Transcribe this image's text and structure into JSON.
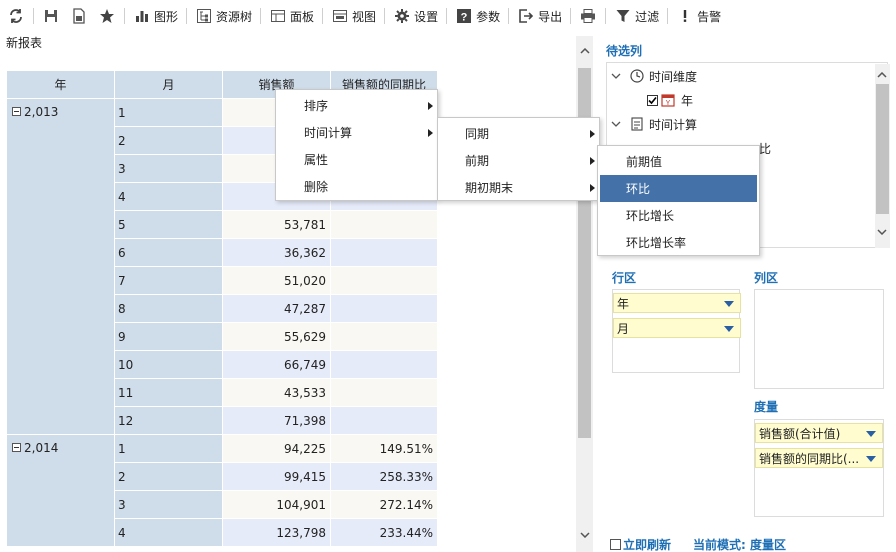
{
  "toolbar": {
    "items": [
      {
        "icon": "refresh-icon",
        "label": ""
      },
      {
        "icon": "save-icon",
        "label": ""
      },
      {
        "icon": "save-as-icon",
        "label": ""
      },
      {
        "icon": "star-icon",
        "label": ""
      },
      {
        "icon": "chart-icon",
        "label": "图形"
      },
      {
        "icon": "resource-tree-icon",
        "label": "资源树"
      },
      {
        "icon": "panel-icon",
        "label": "面板"
      },
      {
        "icon": "view-icon",
        "label": "视图"
      },
      {
        "icon": "gear-icon",
        "label": "设置"
      },
      {
        "icon": "question-icon",
        "label": "参数"
      },
      {
        "icon": "export-icon",
        "label": "导出"
      },
      {
        "icon": "print-icon",
        "label": ""
      },
      {
        "icon": "filter-icon",
        "label": "过滤"
      },
      {
        "icon": "alert-icon",
        "label": "告警"
      }
    ]
  },
  "report": {
    "title": "新报表",
    "headers": {
      "year": "年",
      "month": "月",
      "sales": "销售额",
      "yoy": "销售额的同期比"
    },
    "groups": [
      {
        "year": "2,013",
        "rows": [
          {
            "month": "1",
            "sales": "",
            "yoy": ""
          },
          {
            "month": "2",
            "sales": "",
            "yoy": ""
          },
          {
            "month": "3",
            "sales": "",
            "yoy": ""
          },
          {
            "month": "4",
            "sales": "",
            "yoy": ""
          },
          {
            "month": "5",
            "sales": "53,781",
            "yoy": ""
          },
          {
            "month": "6",
            "sales": "36,362",
            "yoy": ""
          },
          {
            "month": "7",
            "sales": "51,020",
            "yoy": ""
          },
          {
            "month": "8",
            "sales": "47,287",
            "yoy": ""
          },
          {
            "month": "9",
            "sales": "55,629",
            "yoy": ""
          },
          {
            "month": "10",
            "sales": "66,749",
            "yoy": ""
          },
          {
            "month": "11",
            "sales": "43,533",
            "yoy": ""
          },
          {
            "month": "12",
            "sales": "71,398",
            "yoy": ""
          }
        ]
      },
      {
        "year": "2,014",
        "rows": [
          {
            "month": "1",
            "sales": "94,225",
            "yoy": "149.51%"
          },
          {
            "month": "2",
            "sales": "99,415",
            "yoy": "258.33%"
          },
          {
            "month": "3",
            "sales": "104,901",
            "yoy": "272.14%"
          },
          {
            "month": "4",
            "sales": "123,798",
            "yoy": "233.44%"
          }
        ]
      }
    ]
  },
  "context_menu": {
    "level1": [
      "排序",
      "时间计算",
      "属性",
      "删除"
    ],
    "level2": [
      "同期",
      "前期",
      "期初期末"
    ],
    "level3": [
      "前期值",
      "环比",
      "环比增长",
      "环比增长率"
    ],
    "active_level3": "环比"
  },
  "panel": {
    "candidates_title": "待选列",
    "tree": {
      "time_dimension": "时间维度",
      "year_field": "年",
      "time_calc": "时间计算",
      "partial_label": "比"
    },
    "row_zone_title": "行区",
    "row_fields": [
      "年",
      "月"
    ],
    "col_zone_title": "列区",
    "measure_title": "度量",
    "measures": [
      "销售额(合计值)",
      "销售额的同期比(..."
    ],
    "refresh_label": "立即刷新",
    "mode_label": "当前模式: 度量区"
  },
  "colors": {
    "accent": "#1f6fb5",
    "header_bg": "#cfdcea",
    "menu_active": "#4472a8",
    "chip_bg": "#fffdd0"
  }
}
